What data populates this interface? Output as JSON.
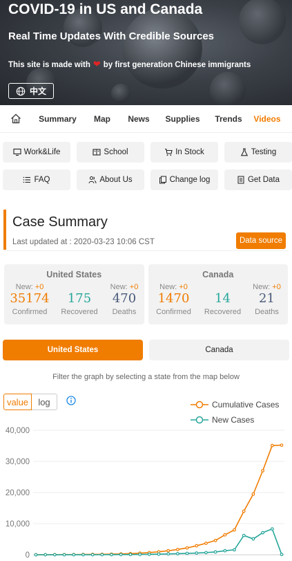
{
  "hero": {
    "title": "COVID-19 in US and Canada",
    "subtitle": "Real Time Updates With Credible Sources",
    "made_prefix": "This site is made with",
    "made_suffix": "by first generation Chinese immigrants",
    "lang_label": "中文"
  },
  "nav": {
    "items": [
      "Summary",
      "Map",
      "News",
      "Supplies",
      "Trends",
      "Videos"
    ],
    "active": "Videos"
  },
  "quick_buttons": [
    {
      "label": "Work&Life",
      "icon": "monitor-icon"
    },
    {
      "label": "School",
      "icon": "book-icon"
    },
    {
      "label": "In Stock",
      "icon": "cart-icon"
    },
    {
      "label": "Testing",
      "icon": "flask-icon"
    },
    {
      "label": "FAQ",
      "icon": "list-icon"
    },
    {
      "label": "About Us",
      "icon": "people-icon"
    },
    {
      "label": "Change log",
      "icon": "copy-icon"
    },
    {
      "label": "Get Data",
      "icon": "document-icon"
    }
  ],
  "summary": {
    "title": "Case Summary",
    "updated": "Last updated at : 2020-03-23 10:06 CST",
    "data_source": "Data source",
    "countries": [
      {
        "name": "United States",
        "confirmed": {
          "new": "+0",
          "value": "35174",
          "label": "Confirmed"
        },
        "recovered": {
          "value": "175",
          "label": "Recovered"
        },
        "deaths": {
          "new": "+0",
          "value": "470",
          "label": "Deaths"
        }
      },
      {
        "name": "Canada",
        "confirmed": {
          "new": "+0",
          "value": "1470",
          "label": "Confirmed"
        },
        "recovered": {
          "value": "14",
          "label": "Recovered"
        },
        "deaths": {
          "new": "+0",
          "value": "21",
          "label": "Deaths"
        }
      }
    ],
    "new_label": "New:"
  },
  "toggle": {
    "selected": "United States",
    "other": "Canada"
  },
  "filter_hint": "Filter the graph by selecting a state from the map below",
  "scale": {
    "value": "value",
    "log": "log",
    "selected": "value"
  },
  "colors": {
    "accent": "#f07c00",
    "teal": "#26a69a",
    "navy": "#4a5a7a"
  },
  "chart_data": {
    "type": "line",
    "ylim": [
      0,
      40000
    ],
    "yticks": [
      "40,000",
      "30,000",
      "20,000",
      "10,000",
      "0"
    ],
    "series": [
      {
        "name": "Cumulative Cases",
        "color": "#f07c00",
        "values": [
          15,
          30,
          45,
          60,
          75,
          100,
          130,
          160,
          200,
          280,
          380,
          520,
          700,
          950,
          1300,
          1700,
          2200,
          2900,
          3700,
          4600,
          6400,
          8000,
          14000,
          19500,
          27000,
          35100,
          35200
        ]
      },
      {
        "name": "New Cases",
        "color": "#26a69a",
        "values": [
          0,
          5,
          5,
          5,
          10,
          15,
          20,
          30,
          40,
          60,
          80,
          110,
          150,
          200,
          280,
          350,
          450,
          550,
          700,
          900,
          1300,
          1600,
          6200,
          5100,
          7100,
          8300,
          100
        ]
      }
    ]
  }
}
